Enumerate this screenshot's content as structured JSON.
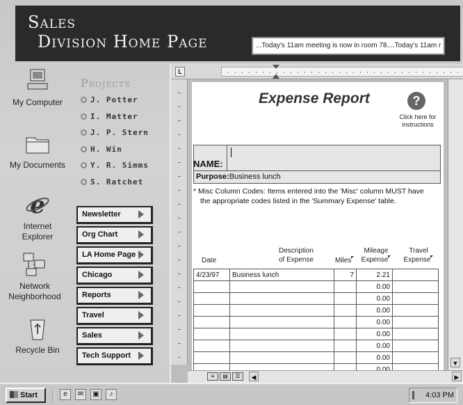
{
  "banner": {
    "title_line1": "Sales",
    "title_line2": "Division Home Page",
    "marquee": "...Today's 11am meeting is now in room 78....Today's 11am r"
  },
  "desktop_icons": [
    {
      "label": "My Computer",
      "icon": "computer-icon"
    },
    {
      "label": "My Documents",
      "icon": "folder-icon"
    },
    {
      "label": "Internet Explorer",
      "icon": "ie-icon"
    },
    {
      "label": "Network Neighborhood",
      "icon": "network-icon"
    },
    {
      "label": "Recycle Bin",
      "icon": "recycle-bin-icon"
    }
  ],
  "projects": {
    "title": "Projects",
    "items": [
      "J. Potter",
      "I. Matter",
      "J. P. Stern",
      "H. Win",
      "Y. R. Simms",
      "S. Ratchet"
    ]
  },
  "nav_links": [
    "Newsletter",
    "Org Chart",
    "LA Home Page",
    "Chicago",
    "Reports",
    "Travel",
    "Sales",
    "Tech Support"
  ],
  "document": {
    "ruler_corner": "L",
    "title": "Expense Report",
    "help_symbol": "?",
    "help_text": "Click here for instructions",
    "name_label": "NAME:",
    "purpose_label": "Purpose:",
    "purpose_value": "Business lunch",
    "misc_note_line1": "* Misc Column Codes:  Items entered into the 'Misc' column MUST have",
    "misc_note_line2": "the appropriate codes listed in the 'Summary Expense' table.",
    "columns": {
      "date": "Date",
      "desc_1": "Description",
      "desc_2": "of Expense",
      "miles": "Miles",
      "mileage_1": "Mileage",
      "mileage_2": "Expense",
      "travel_1": "Travel",
      "travel_2": "Expense"
    },
    "rows": [
      {
        "date": "4/23/97",
        "desc": "Business lunch",
        "miles": "7",
        "mileage": "2.21",
        "travel": ""
      },
      {
        "date": "",
        "desc": "",
        "miles": "",
        "mileage": "0.00",
        "travel": ""
      },
      {
        "date": "",
        "desc": "",
        "miles": "",
        "mileage": "0.00",
        "travel": ""
      },
      {
        "date": "",
        "desc": "",
        "miles": "",
        "mileage": "0.00",
        "travel": ""
      },
      {
        "date": "",
        "desc": "",
        "miles": "",
        "mileage": "0.00",
        "travel": ""
      },
      {
        "date": "",
        "desc": "",
        "miles": "",
        "mileage": "0.00",
        "travel": ""
      },
      {
        "date": "",
        "desc": "",
        "miles": "",
        "mileage": "0.00",
        "travel": ""
      },
      {
        "date": "",
        "desc": "",
        "miles": "",
        "mileage": "0.00",
        "travel": ""
      },
      {
        "date": "",
        "desc": "",
        "miles": "",
        "mileage": "0.00",
        "travel": ""
      }
    ]
  },
  "taskbar": {
    "start_label": "Start",
    "clock": "4:03 PM"
  }
}
